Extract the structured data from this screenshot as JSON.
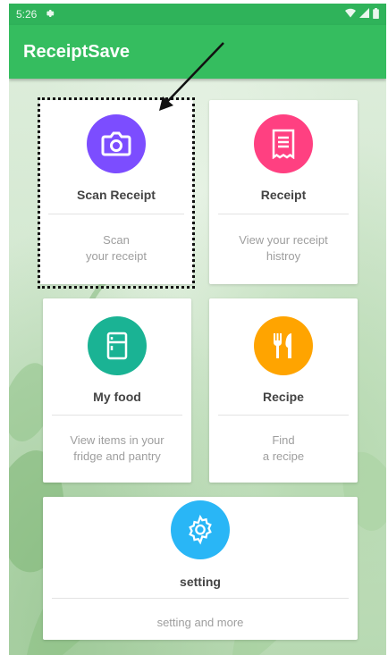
{
  "status_bar": {
    "time": "5:26"
  },
  "app": {
    "title": "ReceiptSave"
  },
  "cards": {
    "scan": {
      "title": "Scan Receipt",
      "description": "Scan\nyour receipt",
      "icon": "camera-icon",
      "color": "#7c4dff"
    },
    "receipt": {
      "title": "Receipt",
      "description": "View your receipt\nhistroy",
      "icon": "receipt-icon",
      "color": "#ff4081"
    },
    "myfood": {
      "title": "My food",
      "description": "View items in your\nfridge and pantry",
      "icon": "fridge-icon",
      "color": "#1ab394"
    },
    "recipe": {
      "title": "Recipe",
      "description": "Find\na recipe",
      "icon": "fork-knife-icon",
      "color": "#ffa400"
    },
    "setting": {
      "title": "setting",
      "description": "setting and more",
      "icon": "gear-icon",
      "color": "#29b6f6"
    }
  },
  "colors": {
    "status_bar": "#2fb35a",
    "app_bar": "#35bd5f"
  }
}
